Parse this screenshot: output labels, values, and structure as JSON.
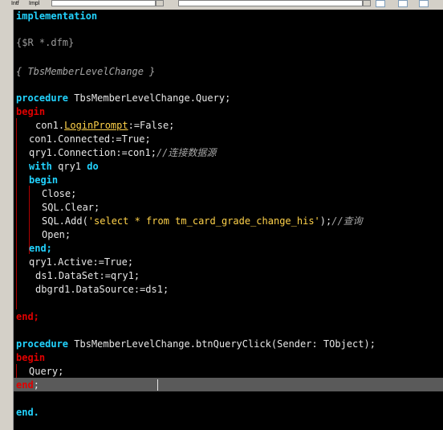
{
  "toolbar": {
    "tab_intf": "Intf",
    "tab_impl": "Impl",
    "combo_left": "▼",
    "combo_right": "▼"
  },
  "code": {
    "implementation": "implementation",
    "directive": "{$R *.dfm}",
    "class_comment": "{ TbsMemberLevelChange }",
    "proc1_kw": "procedure",
    "proc1_name": " TbsMemberLevelChange.Query;",
    "begin1": "begin",
    "l_con1_obj": "con1.",
    "l_con1_prop": "LoginPrompt",
    "l_con1_rest": ":=False;",
    "l_connected": "con1.Connected:=True;",
    "l_qryconn": "qry1.Connection:=con1;",
    "l_qryconn_comment": "//连接数据源",
    "with_kw": "with",
    "with_obj": " qry1 ",
    "do_kw": "do",
    "begin2": "begin",
    "l_close": "Close;",
    "l_clear": "SQL.Clear;",
    "l_add_pre": "SQL.Add(",
    "l_add_str": "'select * from tm_card_grade_change_his'",
    "l_add_post": ");",
    "l_add_comment": "//查询",
    "l_open": "Open;",
    "end2": "end;",
    "l_active": "qry1.Active:=True;",
    "l_dataset": "ds1.DataSet:=qry1;",
    "l_datasource": "dbgrd1.DataSource:=ds1;",
    "end1": "end;",
    "proc2_kw": "procedure",
    "proc2_name": " TbsMemberLevelChange.btnQueryClick(Sender: TObject);",
    "begin3": "begin",
    "l_query": "Query;",
    "end3_kw": "end",
    "end3_semi": ";",
    "final_end": "end."
  },
  "colors": {
    "background": "#000000",
    "keyword": "#22d3ff",
    "identifier": "#e6e6e6",
    "string": "#ffd24a",
    "comment": "#a7a7a7",
    "block_end": "#e00000"
  }
}
